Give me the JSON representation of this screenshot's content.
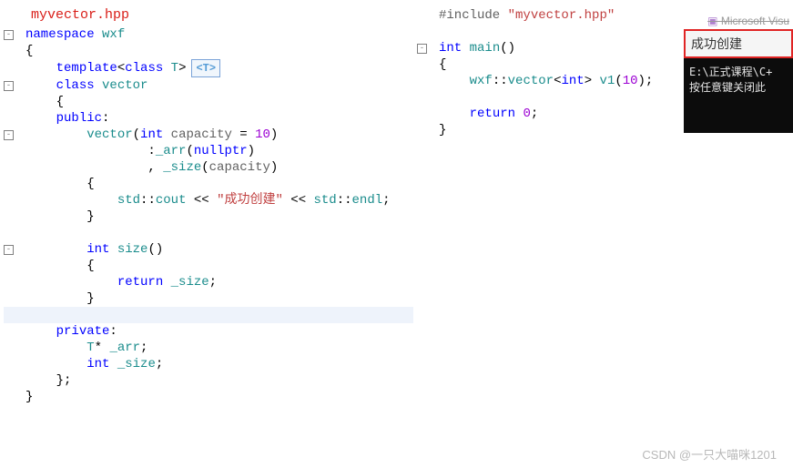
{
  "filename": "myvector.hpp",
  "hint_label": "<T>",
  "left_code": [
    {
      "g": "f",
      "ind": 0,
      "tokens": [
        [
          "k",
          "namespace"
        ],
        [
          "c",
          " "
        ],
        [
          "t",
          "wxf"
        ]
      ]
    },
    {
      "g": " ",
      "ind": 0,
      "tokens": [
        [
          "c",
          "{"
        ]
      ]
    },
    {
      "g": " ",
      "ind": 1,
      "tokens": [
        [
          "k",
          "template"
        ],
        [
          "c",
          "<"
        ],
        [
          "k",
          "class"
        ],
        [
          "c",
          " "
        ],
        [
          "t",
          "T"
        ],
        [
          "c",
          ">"
        ]
      ],
      "hint": true
    },
    {
      "g": "f",
      "ind": 1,
      "tokens": [
        [
          "k",
          "class"
        ],
        [
          "c",
          " "
        ],
        [
          "t",
          "vector"
        ]
      ]
    },
    {
      "g": " ",
      "ind": 1,
      "tokens": [
        [
          "c",
          "{"
        ]
      ]
    },
    {
      "g": " ",
      "ind": 1,
      "tokens": [
        [
          "k",
          "public"
        ],
        [
          "c",
          ":"
        ]
      ]
    },
    {
      "g": "f",
      "ind": 2,
      "tokens": [
        [
          "t",
          "vector"
        ],
        [
          "c",
          "("
        ],
        [
          "k",
          "int"
        ],
        [
          "c",
          " "
        ],
        [
          "p",
          "capacity"
        ],
        [
          "c",
          " = "
        ],
        [
          "n",
          "10"
        ],
        [
          "c",
          ")"
        ]
      ]
    },
    {
      "g": " ",
      "ind": 4,
      "tokens": [
        [
          "c",
          ":"
        ],
        [
          "t",
          "_arr"
        ],
        [
          "c",
          "("
        ],
        [
          "k",
          "nullptr"
        ],
        [
          "c",
          ")"
        ]
      ]
    },
    {
      "g": " ",
      "ind": 4,
      "tokens": [
        [
          "c",
          ", "
        ],
        [
          "t",
          "_size"
        ],
        [
          "c",
          "("
        ],
        [
          "p",
          "capacity"
        ],
        [
          "c",
          ")"
        ]
      ]
    },
    {
      "g": " ",
      "ind": 2,
      "tokens": [
        [
          "c",
          "{"
        ]
      ]
    },
    {
      "g": " ",
      "ind": 3,
      "tokens": [
        [
          "t",
          "std"
        ],
        [
          "c",
          "::"
        ],
        [
          "t",
          "cout"
        ],
        [
          "c",
          " << "
        ],
        [
          "s",
          "\"成功创建\""
        ],
        [
          "c",
          " << "
        ],
        [
          "t",
          "std"
        ],
        [
          "c",
          "::"
        ],
        [
          "t",
          "endl"
        ],
        [
          "c",
          ";"
        ]
      ]
    },
    {
      "g": " ",
      "ind": 2,
      "tokens": [
        [
          "c",
          "}"
        ]
      ]
    },
    {
      "g": " ",
      "ind": 0,
      "tokens": [
        [
          "c",
          ""
        ]
      ]
    },
    {
      "g": "f",
      "ind": 2,
      "tokens": [
        [
          "k",
          "int"
        ],
        [
          "c",
          " "
        ],
        [
          "t",
          "size"
        ],
        [
          "c",
          "()"
        ]
      ]
    },
    {
      "g": " ",
      "ind": 2,
      "tokens": [
        [
          "c",
          "{"
        ]
      ]
    },
    {
      "g": " ",
      "ind": 3,
      "tokens": [
        [
          "k",
          "return"
        ],
        [
          "c",
          " "
        ],
        [
          "t",
          "_size"
        ],
        [
          "c",
          ";"
        ]
      ]
    },
    {
      "g": " ",
      "ind": 2,
      "tokens": [
        [
          "c",
          "}"
        ]
      ]
    },
    {
      "g": " ",
      "ind": 0,
      "tokens": [
        [
          "c",
          ""
        ]
      ],
      "hl": true
    },
    {
      "g": " ",
      "ind": 1,
      "tokens": [
        [
          "k",
          "private"
        ],
        [
          "c",
          ":"
        ]
      ]
    },
    {
      "g": " ",
      "ind": 2,
      "tokens": [
        [
          "t",
          "T"
        ],
        [
          "c",
          "* "
        ],
        [
          "t",
          "_arr"
        ],
        [
          "c",
          ";"
        ]
      ]
    },
    {
      "g": " ",
      "ind": 2,
      "tokens": [
        [
          "k",
          "int"
        ],
        [
          "c",
          " "
        ],
        [
          "t",
          "_size"
        ],
        [
          "c",
          ";"
        ]
      ]
    },
    {
      "g": " ",
      "ind": 1,
      "tokens": [
        [
          "c",
          "};"
        ]
      ]
    },
    {
      "g": " ",
      "ind": 0,
      "tokens": [
        [
          "c",
          "}"
        ]
      ]
    }
  ],
  "right_code": [
    {
      "g": " ",
      "ind": 0,
      "tokens": [
        [
          "p",
          "#include "
        ],
        [
          "s",
          "\"myvector.hpp\""
        ]
      ]
    },
    {
      "g": " ",
      "ind": 0,
      "tokens": [
        [
          "c",
          ""
        ]
      ]
    },
    {
      "g": "f",
      "ind": 0,
      "tokens": [
        [
          "k",
          "int"
        ],
        [
          "c",
          " "
        ],
        [
          "t",
          "main"
        ],
        [
          "c",
          "()"
        ]
      ]
    },
    {
      "g": " ",
      "ind": 0,
      "tokens": [
        [
          "c",
          "{"
        ]
      ]
    },
    {
      "g": " ",
      "ind": 1,
      "tokens": [
        [
          "t",
          "wxf"
        ],
        [
          "c",
          "::"
        ],
        [
          "t",
          "vector"
        ],
        [
          "c",
          "<"
        ],
        [
          "k",
          "int"
        ],
        [
          "c",
          "> "
        ],
        [
          "t",
          "v1"
        ],
        [
          "c",
          "("
        ],
        [
          "n",
          "10"
        ],
        [
          "c",
          ");"
        ]
      ]
    },
    {
      "g": " ",
      "ind": 0,
      "tokens": [
        [
          "c",
          ""
        ]
      ]
    },
    {
      "g": " ",
      "ind": 1,
      "tokens": [
        [
          "k",
          "return"
        ],
        [
          "c",
          " "
        ],
        [
          "n",
          "0"
        ],
        [
          "c",
          ";"
        ]
      ]
    },
    {
      "g": " ",
      "ind": 0,
      "tokens": [
        [
          "c",
          "}"
        ]
      ]
    }
  ],
  "console": {
    "title_strike": "Microsoft Visu",
    "highlight": "成功创建",
    "dark_lines": [
      "E:\\正式课程\\C+",
      "按任意键关闭此"
    ]
  },
  "watermark": "CSDN @一只大喵咪1201"
}
